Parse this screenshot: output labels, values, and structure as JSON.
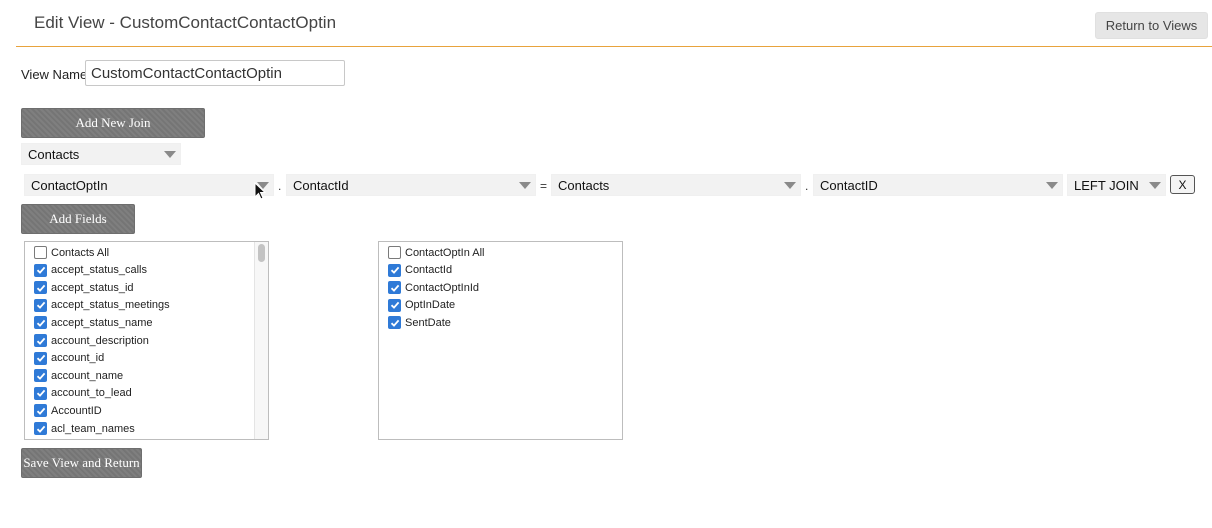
{
  "header": {
    "title": "Edit View - CustomContactContactOptin",
    "return_label": "Return to Views"
  },
  "view_name": {
    "label": "View Name",
    "value": "CustomContactContactOptin"
  },
  "buttons": {
    "add_join": "Add New Join",
    "add_fields": "Add Fields",
    "save": "Save View and Return"
  },
  "base_table": {
    "selected": "Contacts"
  },
  "join": {
    "left_table": "ContactOptIn",
    "left_field": "ContactId",
    "right_table": "Contacts",
    "right_field": "ContactID",
    "join_type": "LEFT JOIN",
    "dot": ".",
    "equals": "=",
    "remove_label": "X"
  },
  "field_lists": [
    {
      "items": [
        {
          "label": "Contacts All",
          "checked": false
        },
        {
          "label": "accept_status_calls",
          "checked": true
        },
        {
          "label": "accept_status_id",
          "checked": true
        },
        {
          "label": "accept_status_meetings",
          "checked": true
        },
        {
          "label": "accept_status_name",
          "checked": true
        },
        {
          "label": "account_description",
          "checked": true
        },
        {
          "label": "account_id",
          "checked": true
        },
        {
          "label": "account_name",
          "checked": true
        },
        {
          "label": "account_to_lead",
          "checked": true
        },
        {
          "label": "AccountID",
          "checked": true
        },
        {
          "label": "acl_team_names",
          "checked": true
        }
      ]
    },
    {
      "items": [
        {
          "label": "ContactOptIn All",
          "checked": false
        },
        {
          "label": "ContactId",
          "checked": true
        },
        {
          "label": "ContactOptInId",
          "checked": true
        },
        {
          "label": "OptInDate",
          "checked": true
        },
        {
          "label": "SentDate",
          "checked": true
        }
      ]
    }
  ],
  "colors": {
    "accent": "#e8a33d",
    "button": "#7a7a7a",
    "checkbox": "#2f7ad7"
  }
}
